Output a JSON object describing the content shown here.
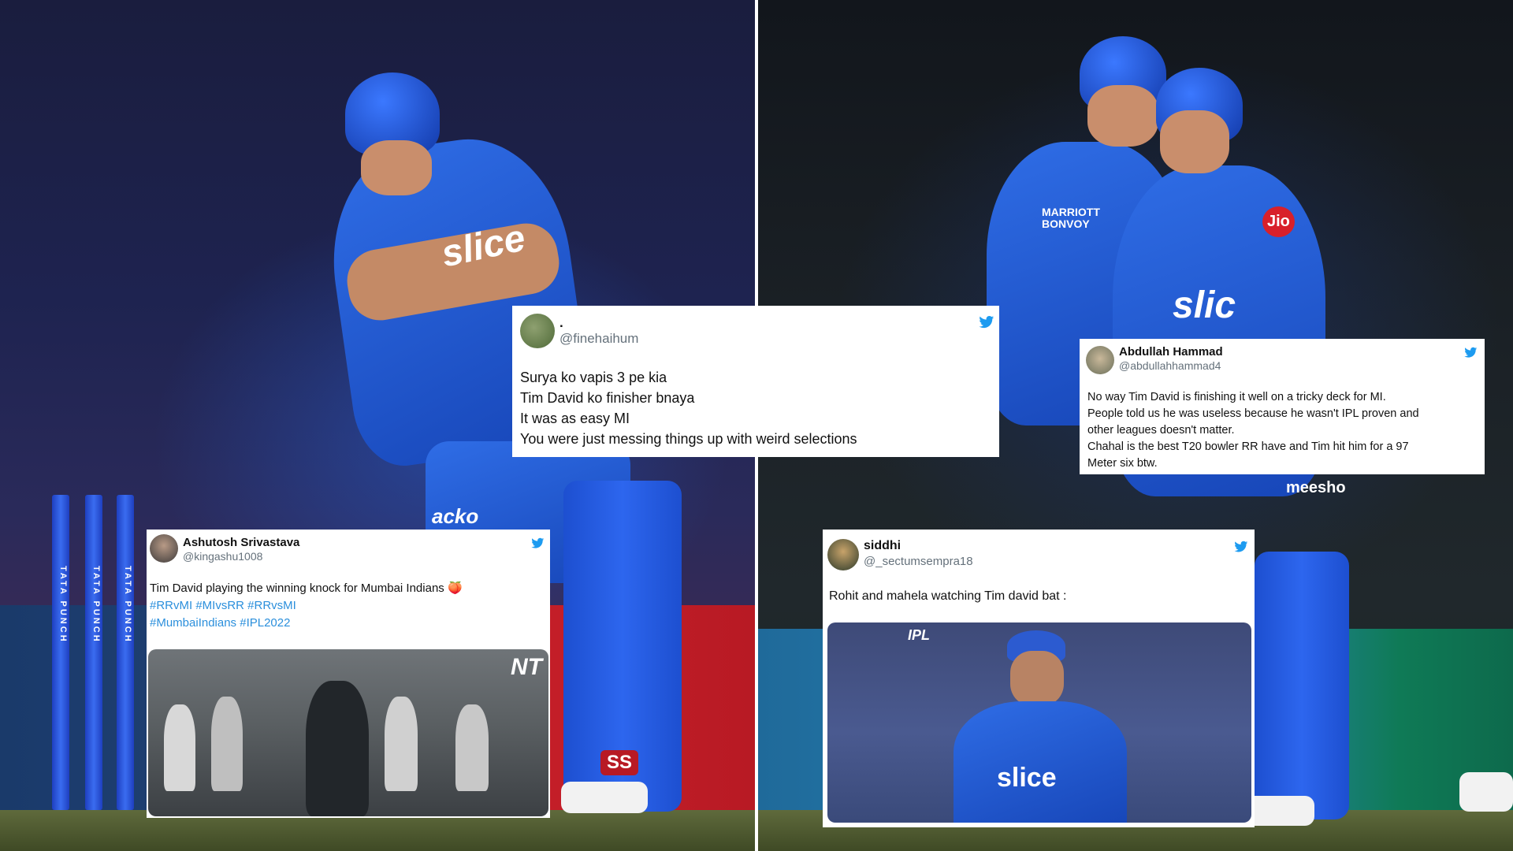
{
  "colors": {
    "mi_blue": "#2f6de6",
    "tweet_bg": "#ffffff",
    "twitter_blue": "#1d9bf0",
    "handle_gray": "#65717b",
    "hashtag_blue": "#2b8fdc"
  },
  "left_photo": {
    "stump_brand": "TATA PUNCH",
    "jersey_sponsor": "slice",
    "pad_logo": "SS",
    "leg_sponsor": "acko"
  },
  "right_photo": {
    "jersey_sponsor": "slic",
    "shirt_brand": "MARRIOTT BONVOY",
    "sleeve_sponsor": "Jio",
    "pants_sponsor": "meesho"
  },
  "tweets": [
    {
      "id": "finehaihum",
      "name": ".",
      "handle": "@finehaihum",
      "icon": "twitter-bird-icon",
      "lines": [
        "Surya ko vapis 3 pe kia",
        "Tim David ko finisher bnaya",
        "It was as easy MI",
        "You were just messing things up with weird selections"
      ]
    },
    {
      "id": "abdullah",
      "name": "Abdullah Hammad",
      "handle": "@abdullahhammad4",
      "icon": "twitter-bird-icon",
      "lines": [
        "No way Tim David is finishing it well on a tricky deck for MI.",
        "People told us he was useless because he wasn't IPL proven and",
        "other leagues doesn't matter.",
        "Chahal is the best T20 bowler RR have and Tim hit him for a 97",
        "Meter six btw."
      ]
    },
    {
      "id": "ashutosh",
      "name": "Ashutosh Srivastava",
      "handle": "@kingashu1008",
      "icon": "twitter-bird-icon",
      "lines": [
        "Tim David playing the winning knock for Mumbai Indians 🍑"
      ],
      "hashtags_line1": "#RRvMI #MIvsRR #RRvsMI",
      "hashtags_line2": "#MumbaiIndians #IPL2022",
      "media_watermark": "NT"
    },
    {
      "id": "siddhi",
      "name": "siddhi",
      "handle": "@_sectumsempra18",
      "icon": "twitter-bird-icon",
      "lines": [
        "Rohit and mahela watching Tim david bat :"
      ],
      "media_shirt_text": "slice",
      "media_corner_logo": "IPL"
    }
  ]
}
